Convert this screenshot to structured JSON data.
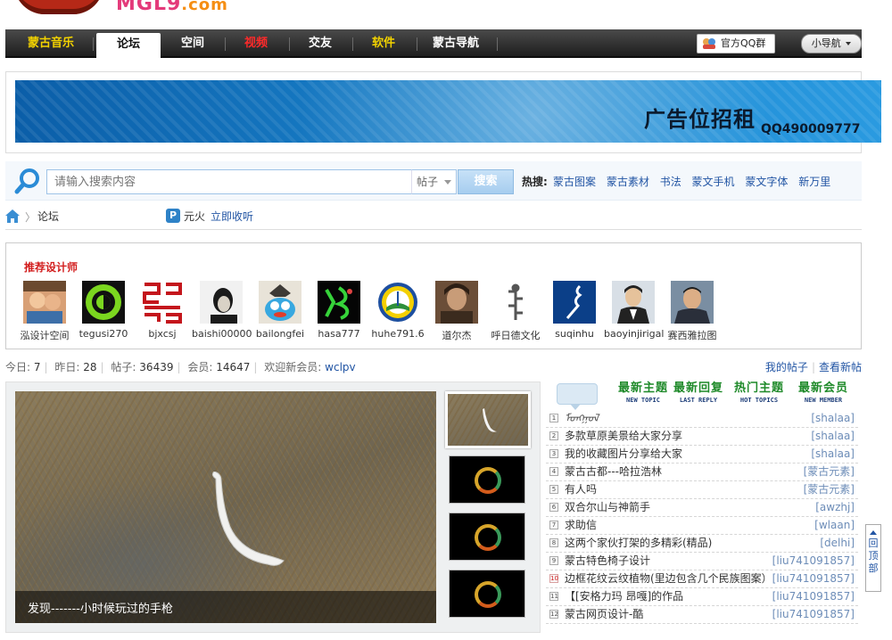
{
  "logo": {
    "text": "MGL9",
    "suffix": ".com"
  },
  "nav": {
    "items": [
      "蒙古音乐",
      "论坛",
      "空间",
      "视频",
      "交友",
      "软件",
      "蒙古导航"
    ],
    "qq_group": "官方QQ群",
    "mini_nav": "小导航"
  },
  "banner": {
    "title": "广告位招租",
    "qq": "QQ490009777"
  },
  "search": {
    "placeholder": "请输入搜索内容",
    "type": "帖子",
    "button": "搜索",
    "hot_label": "热搜:",
    "hot_links": [
      "蒙古图案",
      "蒙古素材",
      "书法",
      "蒙文手机",
      "蒙文字体",
      "新万里"
    ]
  },
  "breadcrumb": {
    "sep": "〉",
    "forum": "论坛",
    "radio_icon": "P",
    "radio_name": "元火",
    "radio_listen": "立即收听"
  },
  "designers": {
    "title": "推荐设计师",
    "items": [
      {
        "name": "泓设计空间"
      },
      {
        "name": "tegusi270"
      },
      {
        "name": "bjxcsj"
      },
      {
        "name": "baishi00000"
      },
      {
        "name": "bailongfei"
      },
      {
        "name": "hasa777"
      },
      {
        "name": "huhe791.6"
      },
      {
        "name": "道尔杰"
      },
      {
        "name": "呼日德文化"
      },
      {
        "name": "suqinhu"
      },
      {
        "name": "baoyinjirigal"
      },
      {
        "name": "赛西雅拉图"
      }
    ]
  },
  "stats": {
    "today_label": "今日:",
    "today": "7",
    "yesterday_label": "昨日:",
    "yesterday": "28",
    "posts_label": "帖子:",
    "posts": "36439",
    "members_label": "会员:",
    "members": "14647",
    "welcome": "欢迎新会员:",
    "new_member": "wclpv",
    "my_posts": "我的帖子",
    "new_posts": "查看新帖"
  },
  "slideshow": {
    "caption": "发现-------小时候玩过的手枪"
  },
  "topics": {
    "tabs": [
      {
        "cn": "最新主题",
        "en": "NEW TOPIC"
      },
      {
        "cn": "最新回复",
        "en": "LAST REPLY"
      },
      {
        "cn": "热门主题",
        "en": "HOT TOPICS"
      },
      {
        "cn": "最新会员",
        "en": "NEW MEMBER"
      }
    ],
    "items": [
      {
        "num": "1",
        "title": "ᠮᠣᠩᠭᠣᠯ",
        "author": "[shalaa]"
      },
      {
        "num": "2",
        "title": "多款草原美景给大家分享",
        "author": "[shalaa]"
      },
      {
        "num": "3",
        "title": "我的收藏图片分享给大家",
        "author": "[shalaa]"
      },
      {
        "num": "4",
        "title": "蒙古古都---哈拉浩林",
        "author": "[蒙古元素]"
      },
      {
        "num": "5",
        "title": "有人吗",
        "author": "[蒙古元素]"
      },
      {
        "num": "6",
        "title": "双合尔山与神箭手",
        "author": "[awzhj]"
      },
      {
        "num": "7",
        "title": "求助信",
        "author": "[wlaan]"
      },
      {
        "num": "8",
        "title": "这两个家伙打架的多精彩(精品)",
        "author": "[delhi]"
      },
      {
        "num": "9",
        "title": "蒙古特色椅子设计",
        "author": "[liu741091857]"
      },
      {
        "num": "10",
        "title": "边框花纹云纹植物(里边包含几个民族图案）",
        "author": "[liu741091857]"
      },
      {
        "num": "11",
        "title": "【[安格力玛 昂嘎]的作品",
        "author": "[liu741091857]"
      },
      {
        "num": "12",
        "title": "蒙古网页设计-酷",
        "author": "[liu741091857]"
      }
    ]
  },
  "back_top": "回顶部",
  "colors": {
    "nav_yellow": "#f2d200",
    "nav_red": "#ff2a2a",
    "link_blue": "#2255a4",
    "designer_title": "#d21e1e",
    "topic_tab_green": "#1f8a2a"
  },
  "icons": [
    "search-icon",
    "home-icon",
    "qq-icon",
    "radio-icon",
    "chevron-down-icon",
    "up-arrow-icon"
  ]
}
